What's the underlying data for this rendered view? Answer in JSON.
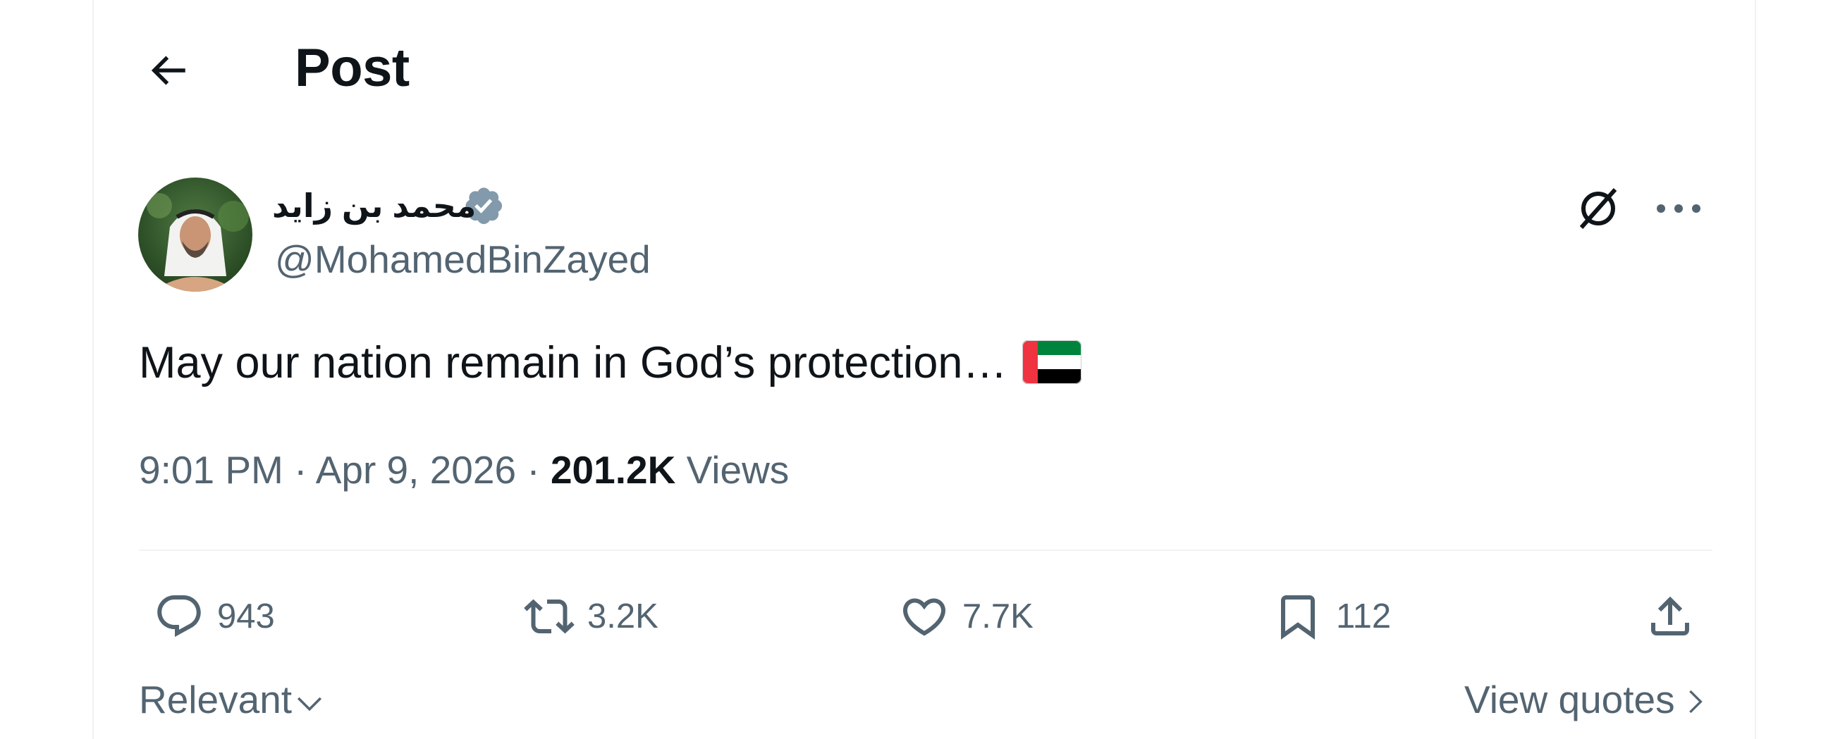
{
  "header": {
    "title": "Post"
  },
  "author": {
    "display_name": "محمد بن زايد",
    "handle": "@MohamedBinZayed",
    "verified_color": "#829aab"
  },
  "post": {
    "text": "May our nation remain in God’s protection…",
    "flag_emoji": "🇦🇪",
    "time": "9:01 PM",
    "separator": "·",
    "date": "Apr 9, 2026",
    "views_count": "201.2K",
    "views_label": "Views"
  },
  "actions": {
    "replies": "943",
    "reposts": "3.2K",
    "likes": "7.7K",
    "bookmarks": "112"
  },
  "footer": {
    "sort_label": "Relevant",
    "view_quotes_label": "View quotes"
  },
  "colors": {
    "text_primary": "#0f1419",
    "text_secondary": "#536471",
    "border": "#eff3f4"
  }
}
